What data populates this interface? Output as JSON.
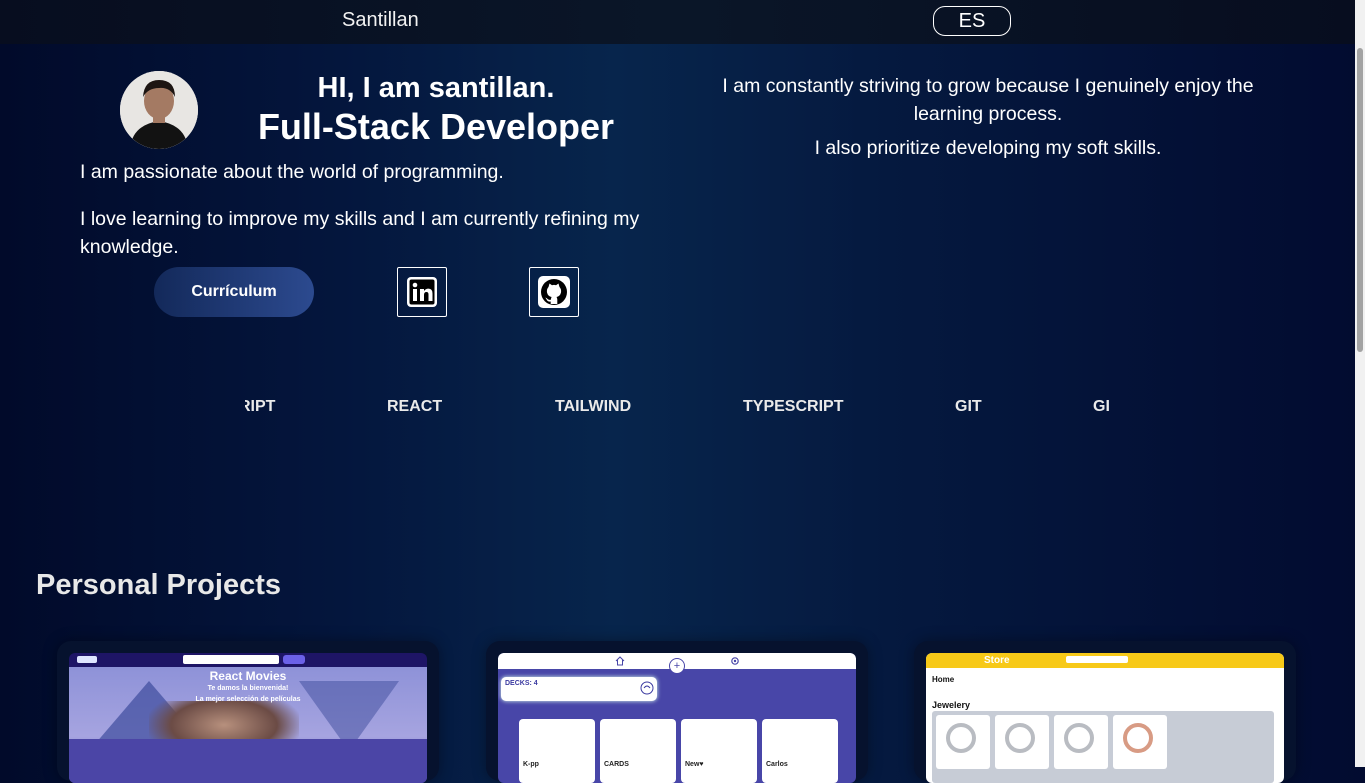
{
  "header": {
    "brand": "Santillan",
    "language_button": "ES"
  },
  "hero": {
    "greeting": "HI, I am santillan.",
    "role": "Full-Stack Developer",
    "intro_1": "I am passionate about the world of programming.",
    "intro_2": "I love learning to improve my skills and I am currently refining my knowledge.",
    "right_1": "I am constantly striving to grow because I genuinely enjoy the learning process.",
    "right_2": "I also prioritize developing my soft skills.",
    "cv_button": "Currículum",
    "linkedin_icon": "linkedin-icon",
    "github_icon": "github-icon"
  },
  "skills": [
    "RIPT",
    "REACT",
    "TAILWIND",
    "TYPESCRIPT",
    "GIT",
    "GI"
  ],
  "projects": {
    "title": "Personal Projects",
    "movies": {
      "title": "React Movies",
      "line1": "Te damos la bienvenida!",
      "line2": "La mejor selección de películas"
    },
    "decks": {
      "counter": "DECKS: 4",
      "cards": [
        "K-pp",
        "CARDS",
        "New♥",
        "Carlos"
      ]
    },
    "store": {
      "brand": "Store",
      "home": "Home",
      "category": "Jewelery"
    }
  },
  "colors": {
    "store_bar": "#f7c918",
    "decks_bg": "#4846a8",
    "movies_bar": "#1e1566"
  }
}
